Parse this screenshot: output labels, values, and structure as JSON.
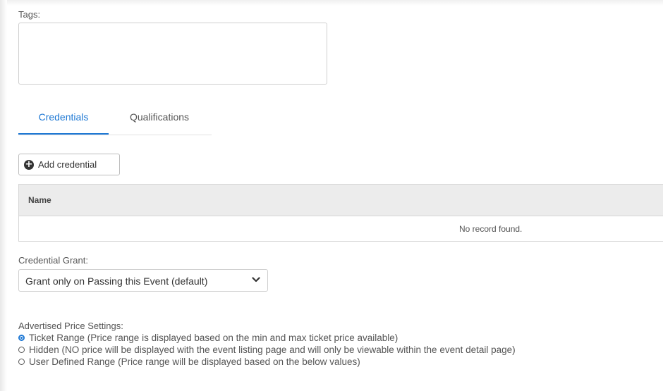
{
  "tags": {
    "label": "Tags:",
    "value": ""
  },
  "tabs": [
    {
      "label": "Credentials",
      "active": true
    },
    {
      "label": "Qualifications",
      "active": false
    }
  ],
  "add_credential": {
    "icon": "plus-circle-icon",
    "label": "Add credential"
  },
  "table": {
    "columns": [
      "Name"
    ],
    "empty_message": "No record found."
  },
  "credential_grant": {
    "label": "Credential Grant:",
    "selected": "Grant only on Passing this Event (default)",
    "icon": "chevron-down-icon"
  },
  "price_settings": {
    "label": "Advertised Price Settings:",
    "options": [
      {
        "label": "Ticket Range (Price range is displayed based on the min and max ticket price available)",
        "checked": true
      },
      {
        "label": "Hidden (NO price will be displayed with the event listing page and will only be viewable within the event detail page)",
        "checked": false
      },
      {
        "label": "User Defined Range (Price range will be displayed based on the below values)",
        "checked": false
      }
    ]
  },
  "colors": {
    "accent": "#1e78d4",
    "table_header_bg": "#ececec",
    "border": "#cfcfcf"
  }
}
